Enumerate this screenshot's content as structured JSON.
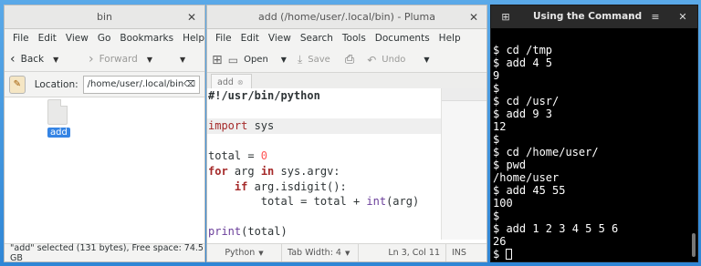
{
  "file_manager": {
    "title": "bin",
    "menu": [
      "File",
      "Edit",
      "View",
      "Go",
      "Bookmarks",
      "Help"
    ],
    "back_label": "Back",
    "forward_label": "Forward",
    "location_label": "Location:",
    "location_value": "/home/user/.local/bin",
    "file_name": "add",
    "status": "\"add\" selected (131 bytes), Free space: 74.5 GB"
  },
  "pluma": {
    "title": "add (/home/user/.local/bin) - Pluma",
    "menu": [
      "File",
      "Edit",
      "View",
      "Search",
      "Tools",
      "Documents",
      "Help"
    ],
    "toolbar": {
      "open": "Open",
      "save": "Save",
      "undo": "Undo"
    },
    "tab_label": "add",
    "code_lines": [
      "#!/usr/bin/python",
      "",
      "import sys",
      "",
      "total = 0",
      "for arg in sys.argv:",
      "    if arg.isdigit():",
      "        total = total + int(arg)",
      "",
      "print(total)"
    ],
    "status": {
      "language": "Python",
      "tab_width": "Tab Width:  4",
      "position": "Ln 3, Col 11",
      "mode": "INS"
    }
  },
  "terminal": {
    "title": "Using the Command",
    "lines": [
      "$ cd /tmp",
      "$ add 4 5",
      "9",
      "$",
      "$ cd /usr/",
      "$ add 9 3",
      "12",
      "$",
      "$ cd /home/user/",
      "$ pwd",
      "/home/user",
      "$ add 45 55",
      "100",
      "$",
      "$ add 1 2 3 4 5 5 6",
      "26",
      "$ "
    ]
  },
  "colors": {
    "accent": "#3584e4",
    "terminal_bg": "#000000",
    "keyword": "#a52a2a"
  }
}
